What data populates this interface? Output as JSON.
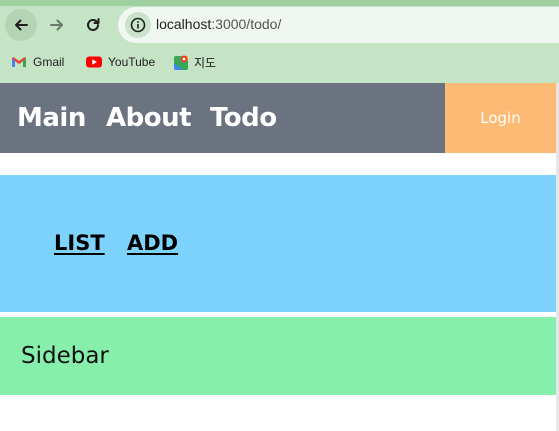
{
  "browser": {
    "url_host": "localhost",
    "url_path": ":3000/todo/",
    "bookmarks": [
      {
        "label": "Gmail",
        "icon": "gmail-icon"
      },
      {
        "label": "YouTube",
        "icon": "youtube-icon"
      },
      {
        "label": "지도",
        "icon": "maps-icon"
      }
    ]
  },
  "header": {
    "nav": [
      {
        "label": "Main"
      },
      {
        "label": "About"
      },
      {
        "label": "Todo"
      }
    ],
    "login_label": "Login"
  },
  "todo_tabs": [
    {
      "label": "LIST"
    },
    {
      "label": "ADD"
    }
  ],
  "sidebar": {
    "title": "Sidebar"
  },
  "colors": {
    "header_bg": "#6b7280",
    "login_bg": "#fdba74",
    "tabs_bg": "#7dd3fc",
    "sidebar_bg": "#86efac",
    "chrome_bg": "#c5e3c5"
  }
}
